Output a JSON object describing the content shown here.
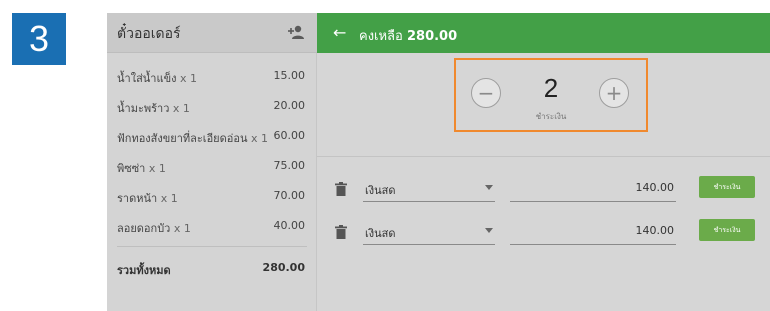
{
  "step": {
    "number": "3"
  },
  "order_panel": {
    "title": "ตั๋วออเดอร์",
    "items": [
      {
        "name": "น้ำใส่น้ำแข็ง",
        "qty": "x 1",
        "price": "15.00"
      },
      {
        "name": "น้ำมะพร้าว",
        "qty": "x 1",
        "price": "20.00"
      },
      {
        "name": "ฟักทองสังขยาที่ละเอียดอ่อน",
        "qty": "x 1",
        "price": "60.00"
      },
      {
        "name": "พิซซ่า",
        "qty": "x 1",
        "price": "75.00"
      },
      {
        "name": "ราดหน้า",
        "qty": "x 1",
        "price": "70.00"
      },
      {
        "name": "ลอยดอกบัว",
        "qty": "x 1",
        "price": "40.00"
      }
    ],
    "total_label": "รวมทั้งหมด",
    "total_value": "280.00"
  },
  "header": {
    "back_icon": "←",
    "remaining_label": "คงเหลือ",
    "remaining_value": "280.00"
  },
  "stepper": {
    "minus": "−",
    "plus": "+",
    "value": "2",
    "caption": "ชำระเงิน"
  },
  "payments": [
    {
      "method": "เงินสด",
      "amount": "140.00",
      "button": "ชำระเงิน"
    },
    {
      "method": "เงินสด",
      "amount": "140.00",
      "button": "ชำระเงิน"
    }
  ],
  "colors": {
    "accent_green": "#43a047",
    "step_badge": "#1a6fb3",
    "highlight_orange": "#f0892e",
    "pay_button": "#6bab4a"
  },
  "icons": {
    "add_user": "add-user-icon",
    "back": "back-arrow-icon",
    "trash": "trash-icon",
    "dropdown": "chevron-down-icon"
  }
}
